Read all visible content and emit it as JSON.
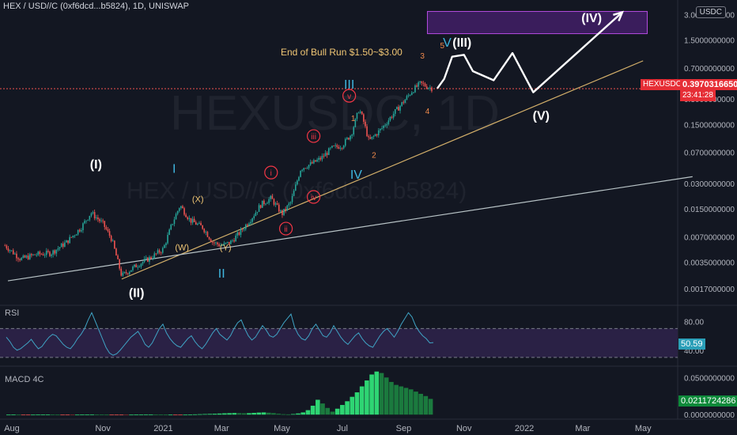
{
  "header": {
    "title": "HEX / USD//C (0xf6dcd...b5824), 1D, UNISWAP"
  },
  "watermark": {
    "line1": "HEXUSDC, 1D",
    "line2": "HEX / USD//C (0xf6dcd...b5824)"
  },
  "currency_badge": "USDC",
  "price_tag": {
    "symbol": "HEXUSDC",
    "price": "0.3970316650",
    "countdown": "23:41:28"
  },
  "annotation": "End of Bull Run $1.50~$3.00",
  "panes": {
    "rsi_label": "RSI",
    "macd_label": "MACD 4C"
  },
  "colors": {
    "background": "#131722",
    "up": "#26a69a",
    "down": "#ef5350",
    "label_red": "#f23645",
    "rsi_line": "#3fa3c4",
    "rsi_band": "#2a2145",
    "trendline_gold": "#d4b06a",
    "trendline_gray": "#b8c3c6",
    "target_box": "#3a1d5c",
    "target_box_border": "#b44ce0"
  },
  "chart_data": [
    {
      "type": "line",
      "name": "price",
      "scale": "log",
      "x_ticks": [
        "Aug",
        "Nov",
        "2021",
        "Mar",
        "May",
        "Jul",
        "Sep",
        "Nov",
        "2022",
        "Mar",
        "May"
      ],
      "y_ticks": [
        "3.0000000000",
        "1.5000000000",
        "0.7000000000",
        "0.3000000000",
        "0.1500000000",
        "0.0700000000",
        "0.0300000000",
        "0.0150000000",
        "0.0070000000",
        "0.0035000000",
        "0.0017000000"
      ],
      "y_tick_values": [
        3.0,
        1.5,
        0.7,
        0.3,
        0.15,
        0.07,
        0.03,
        0.015,
        0.007,
        0.0035,
        0.0017
      ],
      "ylim": [
        0.0011,
        3.6
      ],
      "current_price": 0.397,
      "series_points": [
        [
          "2020-07-25",
          0.0055
        ],
        [
          "2020-08-10",
          0.0038
        ],
        [
          "2020-08-25",
          0.0043
        ],
        [
          "2020-09-10",
          0.0045
        ],
        [
          "2020-09-25",
          0.006
        ],
        [
          "2020-10-10",
          0.009
        ],
        [
          "2020-10-20",
          0.0135
        ],
        [
          "2020-11-01",
          0.01
        ],
        [
          "2020-11-10",
          0.0065
        ],
        [
          "2020-11-20",
          0.0024
        ],
        [
          "2020-12-05",
          0.0032
        ],
        [
          "2020-12-20",
          0.004
        ],
        [
          "2021-01-01",
          0.005
        ],
        [
          "2021-01-10",
          0.01
        ],
        [
          "2021-01-18",
          0.0165
        ],
        [
          "2021-01-28",
          0.011
        ],
        [
          "2021-02-10",
          0.009
        ],
        [
          "2021-02-20",
          0.006
        ],
        [
          "2021-03-01",
          0.0055
        ],
        [
          "2021-03-10",
          0.006
        ],
        [
          "2021-03-20",
          0.008
        ],
        [
          "2021-04-01",
          0.012
        ],
        [
          "2021-04-10",
          0.017
        ],
        [
          "2021-04-20",
          0.02
        ],
        [
          "2021-05-01",
          0.013
        ],
        [
          "2021-05-10",
          0.018
        ],
        [
          "2021-05-20",
          0.045
        ],
        [
          "2021-06-01",
          0.052
        ],
        [
          "2021-06-10",
          0.06
        ],
        [
          "2021-06-20",
          0.078
        ],
        [
          "2021-07-01",
          0.085
        ],
        [
          "2021-07-10",
          0.115
        ],
        [
          "2021-07-18",
          0.23
        ],
        [
          "2021-07-22",
          0.17
        ],
        [
          "2021-07-28",
          0.095
        ],
        [
          "2021-08-10",
          0.135
        ],
        [
          "2021-08-20",
          0.19
        ],
        [
          "2021-09-01",
          0.28
        ],
        [
          "2021-09-10",
          0.38
        ],
        [
          "2021-09-18",
          0.46
        ],
        [
          "2021-09-25",
          0.42
        ],
        [
          "2021-10-01",
          0.397
        ]
      ],
      "projection_path": [
        [
          "2021-10-05",
          0.4
        ],
        [
          "2021-10-12",
          0.52
        ],
        [
          "2021-10-20",
          0.95
        ],
        [
          "2021-11-01",
          1.0
        ],
        [
          "2021-11-10",
          0.64
        ],
        [
          "2021-12-01",
          0.5
        ],
        [
          "2021-12-20",
          1.05
        ],
        [
          "2022-01-10",
          0.36
        ],
        [
          "2022-04-10",
          3.2
        ]
      ],
      "target_range": [
        1.5,
        3.0
      ],
      "trendlines": [
        {
          "name": "gold",
          "from": [
            "2020-11-20",
            0.0022
          ],
          "to": [
            "2022-05-01",
            0.85
          ]
        },
        {
          "name": "gray",
          "from": [
            "2020-07-28",
            0.0021
          ],
          "to": [
            "2022-06-20",
            0.036
          ]
        }
      ],
      "wave_labels": [
        {
          "text": "(I)",
          "style": "white",
          "at": [
            "2020-10-25",
            0.045
          ]
        },
        {
          "text": "(II)",
          "style": "white",
          "at": [
            "2020-12-05",
            0.00135
          ]
        },
        {
          "text": "I",
          "style": "cyan",
          "at": [
            "2021-01-12",
            0.04
          ]
        },
        {
          "text": "II",
          "style": "cyan",
          "at": [
            "2021-03-01",
            0.0023
          ]
        },
        {
          "text": "III",
          "style": "cyan",
          "at": [
            "2021-07-08",
            0.4
          ]
        },
        {
          "text": "IV",
          "style": "cyan",
          "at": [
            "2021-07-15",
            0.034
          ]
        },
        {
          "text": "V",
          "style": "cyan",
          "at": [
            "2021-10-15",
            1.25
          ]
        },
        {
          "text": "(III)",
          "style": "white",
          "at": [
            "2021-10-30",
            1.25
          ]
        },
        {
          "text": "(IV)",
          "style": "white",
          "at": [
            "2022-03-10",
            2.45
          ]
        },
        {
          "text": "(V)",
          "style": "white",
          "at": [
            "2022-01-18",
            0.17
          ]
        },
        {
          "text": "(X)",
          "style": "orange",
          "at": [
            "2021-02-05",
            0.018
          ]
        },
        {
          "text": "(W)",
          "style": "orange",
          "at": [
            "2021-01-20",
            0.0048
          ]
        },
        {
          "text": "(Y)",
          "style": "orange",
          "at": [
            "2021-03-05",
            0.0048
          ]
        },
        {
          "text": "1",
          "style": "orange-sm",
          "at": [
            "2021-07-12",
            0.165
          ]
        },
        {
          "text": "2",
          "style": "orange-sm",
          "at": [
            "2021-08-02",
            0.06
          ]
        },
        {
          "text": "3",
          "style": "orange-sm",
          "at": [
            "2021-09-20",
            0.9
          ]
        },
        {
          "text": "4",
          "style": "orange-sm",
          "at": [
            "2021-09-25",
            0.2
          ]
        },
        {
          "text": "5",
          "style": "orange-sm",
          "at": [
            "2021-10-10",
            1.2
          ]
        },
        {
          "text": "i",
          "style": "circle",
          "at": [
            "2021-04-20",
            0.037
          ]
        },
        {
          "text": "ii",
          "style": "circle",
          "at": [
            "2021-05-05",
            0.008
          ]
        },
        {
          "text": "iii",
          "style": "circle",
          "at": [
            "2021-06-02",
            0.1
          ]
        },
        {
          "text": "iv",
          "style": "circle",
          "at": [
            "2021-06-02",
            0.019
          ]
        },
        {
          "text": "v",
          "style": "circle",
          "at": [
            "2021-07-08",
            0.3
          ]
        }
      ]
    },
    {
      "type": "line",
      "name": "RSI",
      "ylim": [
        20,
        100
      ],
      "bands": [
        70,
        30
      ],
      "y_ticks": [
        "80.00",
        "40.00"
      ],
      "y_tick_values": [
        80,
        40
      ],
      "current": "50.59",
      "values": [
        58,
        52,
        44,
        40,
        42,
        46,
        50,
        55,
        48,
        42,
        45,
        52,
        58,
        62,
        60,
        54,
        48,
        44,
        42,
        48,
        56,
        62,
        70,
        82,
        92,
        80,
        68,
        56,
        44,
        36,
        33,
        35,
        40,
        46,
        52,
        58,
        62,
        66,
        58,
        48,
        44,
        50,
        60,
        70,
        76,
        64,
        56,
        50,
        46,
        44,
        50,
        56,
        60,
        52,
        46,
        42,
        48,
        56,
        64,
        70,
        62,
        58,
        54,
        60,
        70,
        78,
        82,
        70,
        60,
        54,
        58,
        66,
        74,
        68,
        60,
        58,
        62,
        70,
        78,
        84,
        90,
        72,
        62,
        56,
        54,
        60,
        70,
        76,
        68,
        60,
        58,
        64,
        74,
        66,
        58,
        52,
        48,
        54,
        60,
        64,
        56,
        50,
        46,
        44,
        52,
        60,
        66,
        70,
        64,
        58,
        66,
        76,
        84,
        92,
        86,
        74,
        66,
        60,
        56,
        50,
        50.59
      ]
    },
    {
      "type": "bar",
      "name": "MACD 4C",
      "current": "0.0211724286",
      "y_ticks": [
        "0.0500000000",
        "0.0000000000"
      ],
      "y_tick_values": [
        0.05,
        0.0
      ],
      "ylim": [
        -0.004,
        0.062
      ],
      "values": [
        0.0,
        0.0001,
        0.0,
        -0.0001,
        -0.0001,
        0.0,
        0.0001,
        0.0001,
        0.0002,
        0.0001,
        0.0,
        -0.0001,
        -0.0002,
        -0.0001,
        0.0,
        0.0001,
        0.0002,
        0.0003,
        0.0002,
        0.0001,
        0.0,
        -0.0001,
        -0.0002,
        -0.0002,
        -0.0001,
        0.0,
        0.0001,
        0.0002,
        0.0003,
        0.0003,
        0.0002,
        0.0001,
        0.0,
        0.0,
        -0.0001,
        -0.0001,
        0.0,
        0.0002,
        0.0004,
        0.0006,
        0.0008,
        0.001,
        0.0012,
        0.0015,
        0.0018,
        0.002,
        0.0022,
        0.002,
        0.0018,
        0.002,
        0.0024,
        0.0028,
        0.003,
        0.0026,
        0.002,
        0.0012,
        0.0006,
        0.0004,
        0.0008,
        0.0016,
        0.003,
        0.006,
        0.012,
        0.02,
        0.015,
        0.009,
        0.004,
        0.008,
        0.013,
        0.018,
        0.024,
        0.03,
        0.038,
        0.046,
        0.054,
        0.058,
        0.056,
        0.05,
        0.044,
        0.04,
        0.038,
        0.036,
        0.034,
        0.031,
        0.028,
        0.025,
        0.0211724286
      ]
    }
  ]
}
